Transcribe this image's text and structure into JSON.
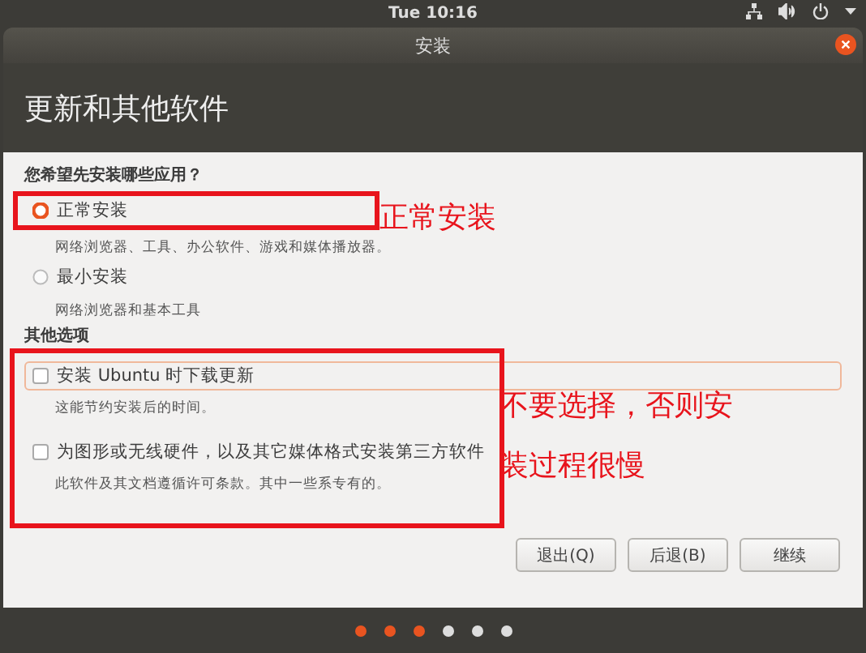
{
  "top_bar": {
    "clock": "Tue 10:16"
  },
  "window": {
    "title": "安装",
    "heading": "更新和其他软件"
  },
  "install_type": {
    "question": "您希望先安装哪些应用？",
    "choices": [
      {
        "label": "正常安装",
        "description": "网络浏览器、工具、办公软件、游戏和媒体播放器。",
        "selected": true
      },
      {
        "label": "最小安装",
        "description": "网络浏览器和基本工具",
        "selected": false
      }
    ]
  },
  "other_options": {
    "heading": "其他选项",
    "options": [
      {
        "label": "安装 Ubuntu 时下载更新",
        "description": "这能节约安装后的时间。",
        "checked": false,
        "focused": true
      },
      {
        "label": "为图形或无线硬件，以及其它媒体格式安装第三方软件",
        "description": "此软件及其文档遵循许可条款。其中一些系专有的。",
        "checked": false,
        "focused": false
      }
    ]
  },
  "buttons": [
    "退出(Q)",
    "后退(B)",
    "继续"
  ],
  "progress_dots": [
    {
      "done": true
    },
    {
      "done": true
    },
    {
      "done": true
    },
    {
      "done": false
    },
    {
      "done": false
    },
    {
      "done": false
    }
  ],
  "annotations": [
    {
      "text": "正常安装"
    },
    {
      "text": "不要选择，否则安装过程很慢"
    }
  ]
}
